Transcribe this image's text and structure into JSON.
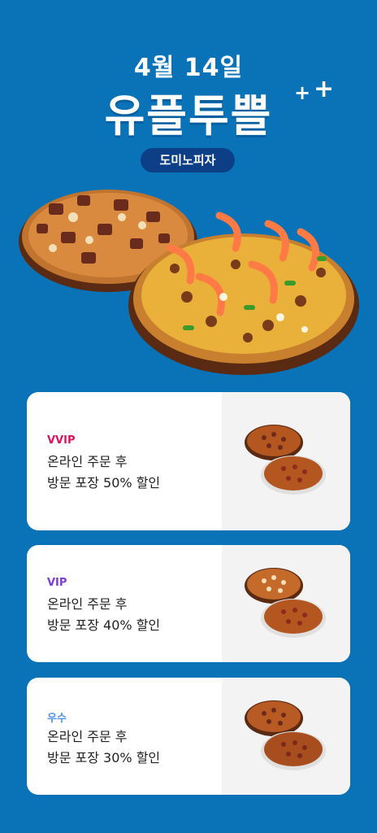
{
  "header": {
    "date": "4월 14일",
    "title": "유플투쁠",
    "plus_glyph": "+",
    "brand": "도미노피자"
  },
  "colors": {
    "background": "#0a72b6",
    "brand_pill": "#0c3f86",
    "vvip": "#e0125b",
    "vip": "#7a3ed6",
    "regular": "#4f8ff0"
  },
  "offers": [
    {
      "tier": "VVIP",
      "line1": "온라인 주문 후",
      "line2": "방문 포장 50% 할인"
    },
    {
      "tier": "VIP",
      "line1": "온라인 주문 후",
      "line2": "방문 포장 40% 할인"
    },
    {
      "tier": "우수",
      "line1": "온라인 주문 후",
      "line2": "방문 포장 30% 할인"
    }
  ]
}
